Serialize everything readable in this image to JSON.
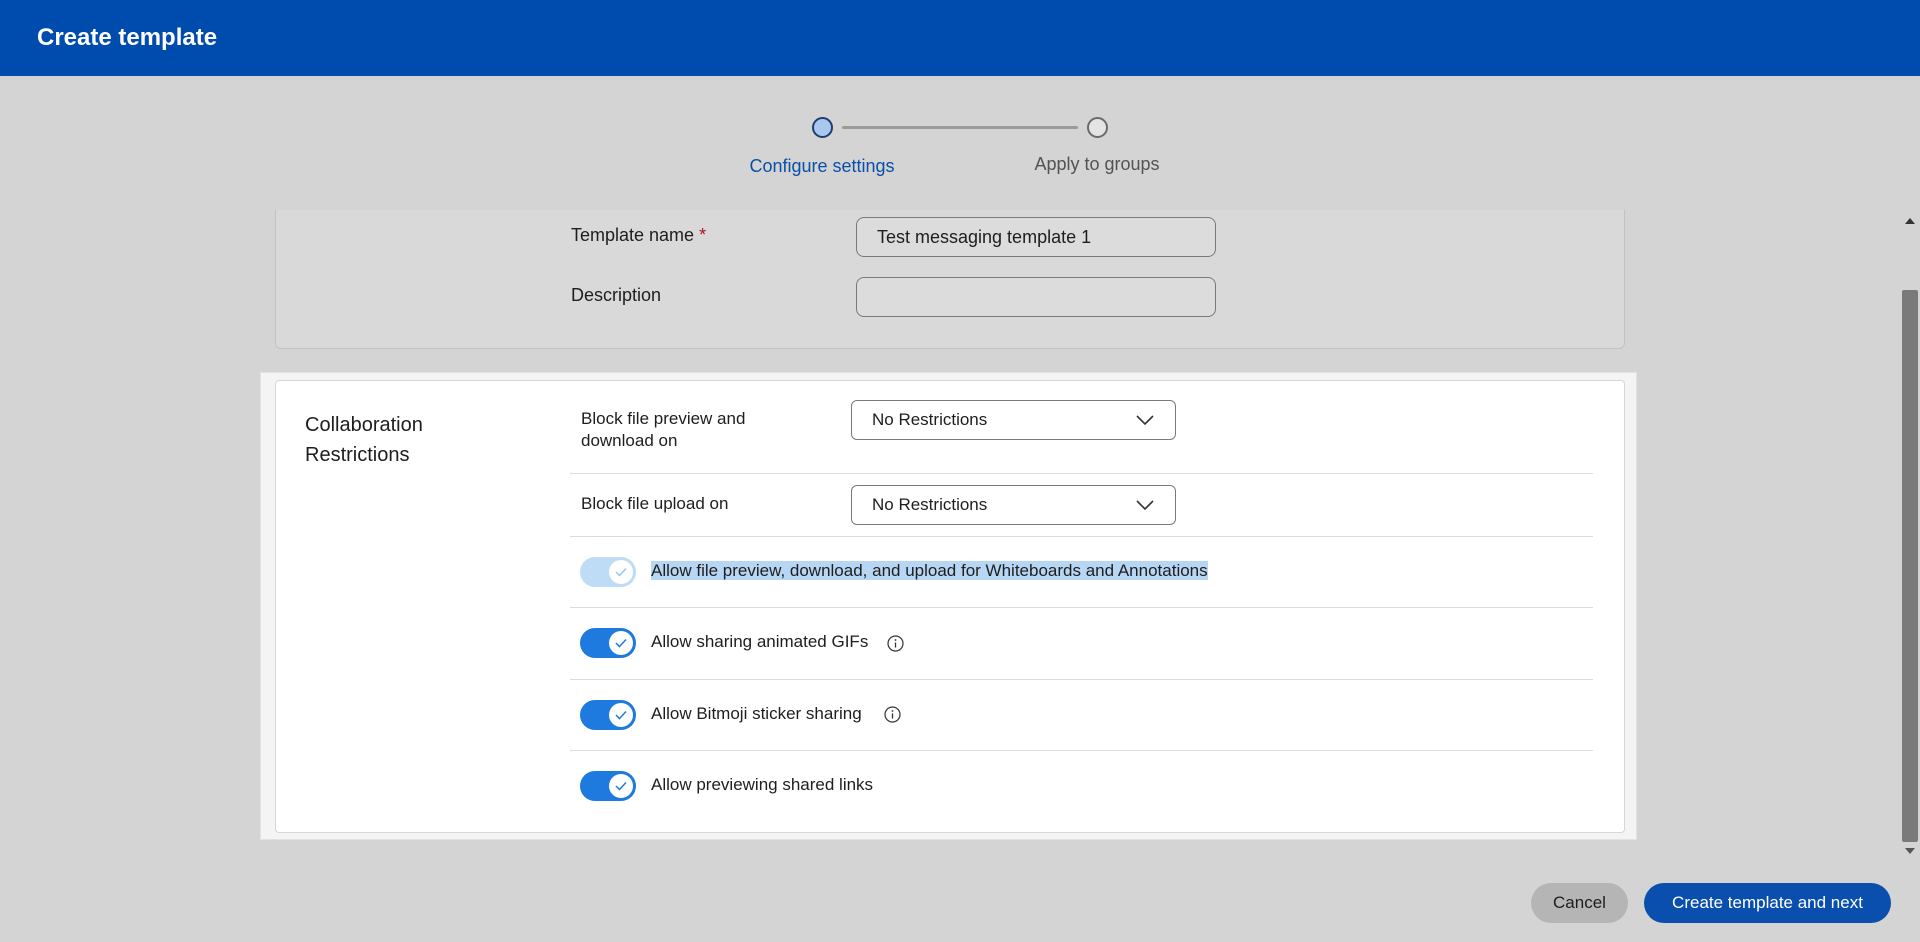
{
  "header": {
    "title": "Create template"
  },
  "stepper": {
    "steps": [
      {
        "label": "Configure settings",
        "state": "active"
      },
      {
        "label": "Apply to groups",
        "state": "inactive"
      }
    ]
  },
  "general": {
    "template_name_label": "Template name",
    "required_mark": "*",
    "template_name_value": "Test messaging template 1",
    "description_label": "Description",
    "description_value": ""
  },
  "collaboration": {
    "title": "Collaboration Restrictions",
    "block_preview_label": "Block file preview and download on",
    "block_preview_value": "No Restrictions",
    "block_upload_label": "Block file upload on",
    "block_upload_value": "No Restrictions",
    "toggles": [
      {
        "label": "Allow file preview, download, and upload for Whiteboards and Annotations",
        "on": true,
        "disabled": true,
        "info": false
      },
      {
        "label": "Allow sharing animated GIFs",
        "on": true,
        "disabled": false,
        "info": true
      },
      {
        "label": "Allow Bitmoji sticker sharing",
        "on": true,
        "disabled": false,
        "info": true
      },
      {
        "label": "Allow previewing shared links",
        "on": true,
        "disabled": false,
        "info": false
      }
    ]
  },
  "footer": {
    "cancel_label": "Cancel",
    "primary_label": "Create template and next"
  },
  "colors": {
    "header_bg": "#004bae",
    "accent": "#1f7ae0",
    "primary_button": "#0a4fae"
  }
}
